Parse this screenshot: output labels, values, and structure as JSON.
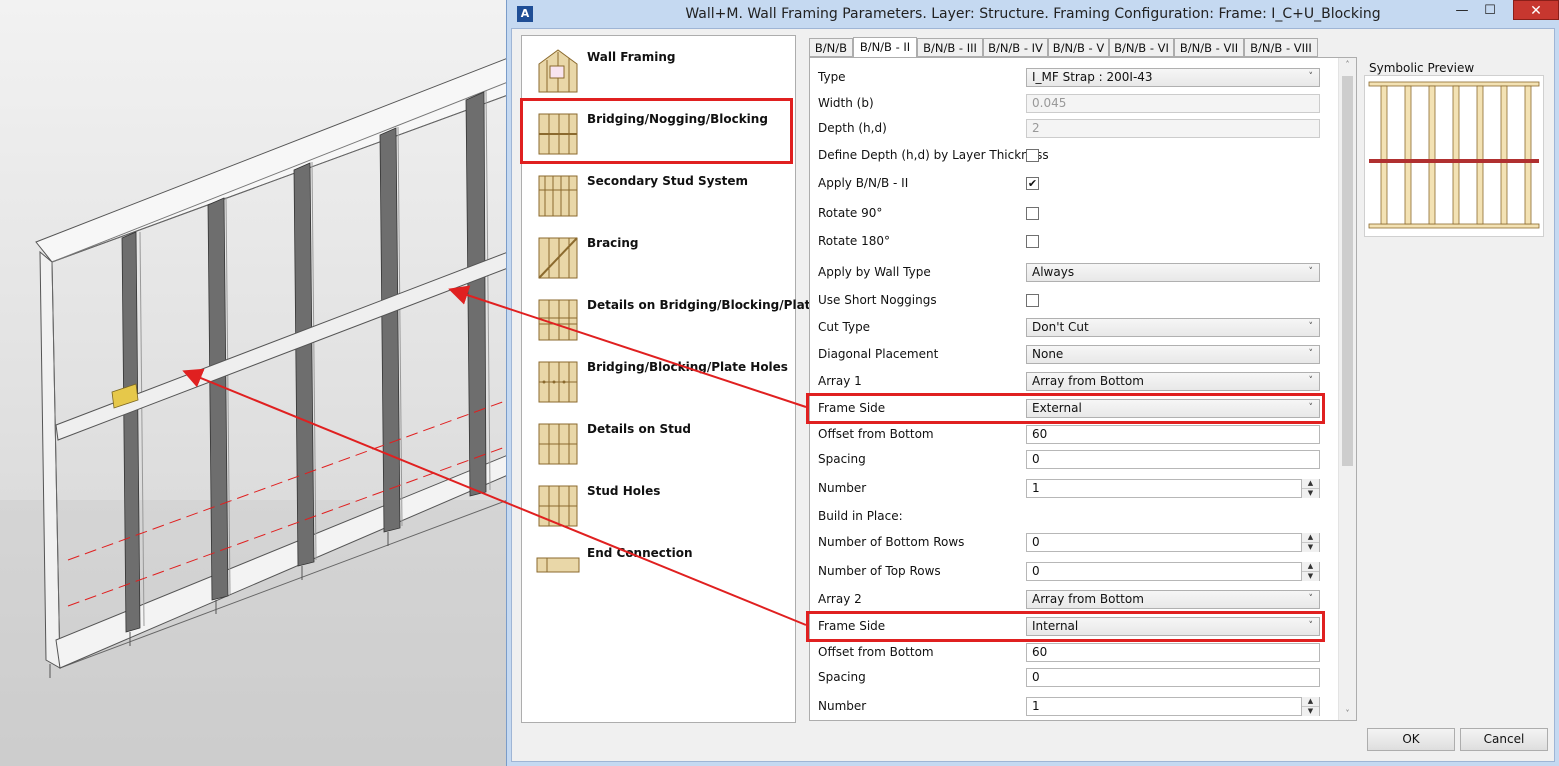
{
  "window": {
    "title": "Wall+M. Wall Framing Parameters. Layer: Structure. Framing Configuration: Frame: I_C+U_Blocking",
    "minimize_glyph": "—",
    "maximize_glyph": "☐",
    "close_glyph": "✕"
  },
  "categories": [
    {
      "label": "Wall Framing",
      "icon": "wall-framing-icon"
    },
    {
      "label": "Bridging/Nogging/Blocking",
      "icon": "bridging-icon",
      "selected": true
    },
    {
      "label": "Secondary Stud System",
      "icon": "secondary-stud-icon"
    },
    {
      "label": "Bracing",
      "icon": "bracing-icon"
    },
    {
      "label": "Details on Bridging/Blocking/Plate",
      "icon": "details-bridging-icon"
    },
    {
      "label": "Bridging/Blocking/Plate Holes",
      "icon": "plate-holes-icon"
    },
    {
      "label": "Details on Stud",
      "icon": "details-stud-icon"
    },
    {
      "label": "Stud Holes",
      "icon": "stud-holes-icon"
    },
    {
      "label": "End Connection",
      "icon": "end-connection-icon"
    }
  ],
  "tabs": [
    "B/N/B",
    "B/N/B - II",
    "B/N/B - III",
    "B/N/B - IV",
    "B/N/B - V",
    "B/N/B - VI",
    "B/N/B - VII",
    "B/N/B - VIII"
  ],
  "active_tab": "B/N/B - II",
  "params": {
    "type": {
      "label": "Type",
      "value": "I_MF Strap : 200I-43"
    },
    "width": {
      "label": "Width (b)",
      "value": "0.045"
    },
    "depth": {
      "label": "Depth (h,d)",
      "value": "2"
    },
    "define_depth": {
      "label": "Define Depth (h,d) by Layer Thickness",
      "checked": false
    },
    "apply_bnb": {
      "label": "Apply B/N/B - II",
      "checked": true,
      "check_glyph": "✔"
    },
    "rotate90": {
      "label": "Rotate 90°",
      "checked": false
    },
    "rotate180": {
      "label": "Rotate 180°",
      "checked": false
    },
    "apply_by_wall_type": {
      "label": "Apply by Wall Type",
      "value": "Always"
    },
    "use_short_noggings": {
      "label": "Use Short Noggings",
      "checked": false
    },
    "cut_type": {
      "label": "Cut Type",
      "value": "Don't Cut"
    },
    "diagonal_placement": {
      "label": "Diagonal Placement",
      "value": "None"
    },
    "array1": {
      "label": "Array 1",
      "value": "Array from Bottom"
    },
    "frame_side1": {
      "label": "Frame Side",
      "value": "External"
    },
    "offset1": {
      "label": "Offset from Bottom",
      "value": "60"
    },
    "spacing1": {
      "label": "Spacing",
      "value": "0"
    },
    "number1": {
      "label": "Number",
      "value": "1"
    },
    "build_in_place": {
      "label": "Build in Place:"
    },
    "bottom_rows": {
      "label": "Number of Bottom Rows",
      "value": "0"
    },
    "top_rows": {
      "label": "Number of Top Rows",
      "value": "0"
    },
    "array2": {
      "label": "Array 2",
      "value": "Array from Bottom"
    },
    "frame_side2": {
      "label": "Frame Side",
      "value": "Internal"
    },
    "offset2": {
      "label": "Offset from Bottom",
      "value": "60"
    },
    "spacing2": {
      "label": "Spacing",
      "value": "0"
    },
    "number2": {
      "label": "Number",
      "value": "1"
    }
  },
  "preview": {
    "title": "Symbolic Preview"
  },
  "buttons": {
    "ok": "OK",
    "cancel": "Cancel"
  },
  "glyphs": {
    "dropdown": "˅",
    "spin_up": "▲",
    "spin_down": "▼",
    "scroll_up": "˄",
    "scroll_down": "˅"
  },
  "colors": {
    "highlight": "#e02020",
    "stud": "#d9b97a",
    "stud_dark": "#8b6a2e",
    "nogging": "#b03030"
  }
}
